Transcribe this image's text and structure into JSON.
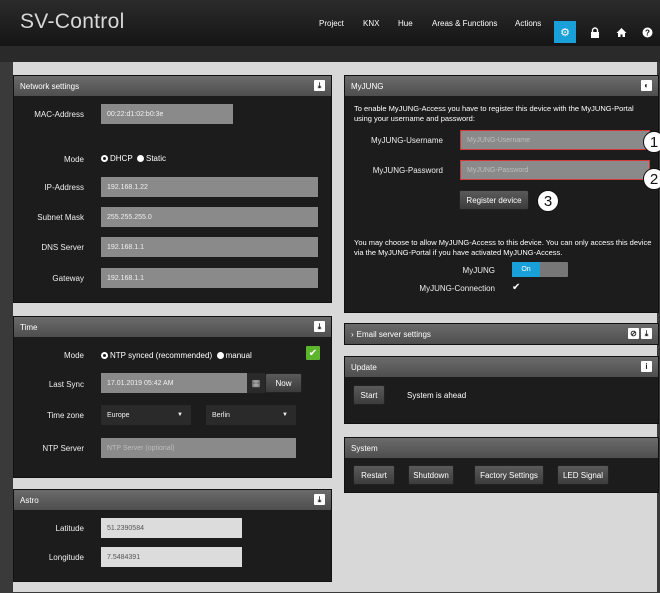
{
  "app": {
    "title": "SV-Control"
  },
  "nav": {
    "items": [
      {
        "label": "Project"
      },
      {
        "label": "KNX"
      },
      {
        "label": "Hue"
      },
      {
        "label": "Areas & Functions"
      },
      {
        "label": "Actions"
      }
    ]
  },
  "network": {
    "title": "Network settings",
    "mac_label": "MAC-Address",
    "mac_value": "00:22:d1:02:b0:3e",
    "mode_label": "Mode",
    "mode_dhcp": "DHCP",
    "mode_static": "Static",
    "ip_label": "IP-Address",
    "ip_value": "192.168.1.22",
    "subnet_label": "Subnet Mask",
    "subnet_value": "255.255.255.0",
    "dns_label": "DNS Server",
    "dns_value": "192.168.1.1",
    "gateway_label": "Gateway",
    "gateway_value": "192.168.1.1"
  },
  "time": {
    "title": "Time",
    "mode_label": "Mode",
    "mode_ntp": "NTP synced (recommended)",
    "mode_manual": "manual",
    "lastsync_label": "Last Sync",
    "lastsync_value": "17.01.2019 05:42 AM",
    "now_label": "Now",
    "tz_label": "Time zone",
    "tz_region": "Europe",
    "tz_city": "Berlin",
    "ntp_label": "NTP Server",
    "ntp_placeholder": "NTP Server (optional)"
  },
  "astro": {
    "title": "Astro",
    "lat_label": "Latitude",
    "lat_value": "51.2390584",
    "lon_label": "Longitude",
    "lon_value": "7.5484391"
  },
  "myjung": {
    "title": "MyJUNG",
    "intro": "To enable MyJUNG-Access you have to register this device with the MyJUNG-Portal using your username and password:",
    "user_label": "MyJUNG-Username",
    "user_placeholder": "MyJUNG-Username",
    "pass_label": "MyJUNG-Password",
    "pass_placeholder": "MyJUNG-Password",
    "register_label": "Register device",
    "allow_text": "You may choose to allow MyJUNG-Access to this device. You can only access this device via the MyJUNG-Portal if you have activated MyJUNG-Access.",
    "toggle_label": "MyJUNG",
    "toggle_on": "On",
    "connection_label": "MyJUNG-Connection",
    "connection_status": "✔",
    "markers": [
      "1",
      "2",
      "3"
    ]
  },
  "email": {
    "title": "Email server settings"
  },
  "update": {
    "title": "Update",
    "start_label": "Start",
    "status": "System is ahead"
  },
  "system": {
    "title": "System",
    "buttons": [
      {
        "label": "Restart"
      },
      {
        "label": "Shutdown"
      },
      {
        "label": "Factory Settings"
      },
      {
        "label": "LED Signal"
      }
    ]
  },
  "colors": {
    "accent": "#1aa0d8",
    "success": "#5cb52d",
    "error_border": "#d23a3a"
  }
}
